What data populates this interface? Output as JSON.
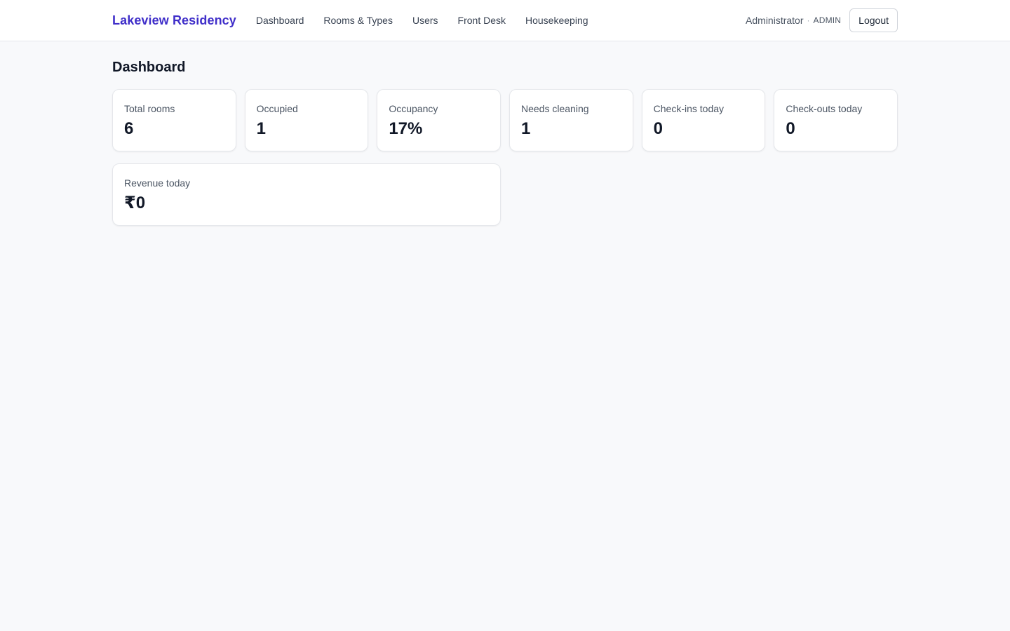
{
  "header": {
    "brand": "Lakeview Residency",
    "nav": [
      {
        "label": "Dashboard"
      },
      {
        "label": "Rooms & Types"
      },
      {
        "label": "Users"
      },
      {
        "label": "Front Desk"
      },
      {
        "label": "Housekeeping"
      }
    ],
    "user_name": "Administrator",
    "separator": "·",
    "role": "ADMIN",
    "logout_label": "Logout"
  },
  "page": {
    "title": "Dashboard"
  },
  "stats": [
    {
      "label": "Total rooms",
      "value": "6"
    },
    {
      "label": "Occupied",
      "value": "1"
    },
    {
      "label": "Occupancy",
      "value": "17%"
    },
    {
      "label": "Needs cleaning",
      "value": "1"
    },
    {
      "label": "Check-ins today",
      "value": "0"
    },
    {
      "label": "Check-outs today",
      "value": "0"
    },
    {
      "label": "Revenue today",
      "value": "₹0"
    }
  ],
  "colors": {
    "brand": "#3f2ec9",
    "background": "#f8f9fb",
    "card": "#ffffff"
  }
}
